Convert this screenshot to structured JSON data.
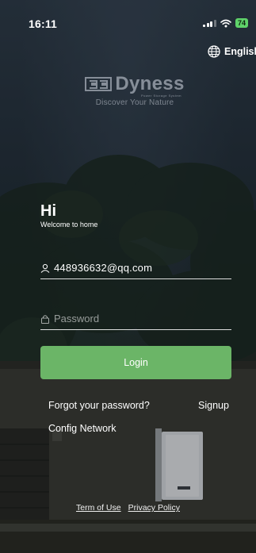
{
  "status_bar": {
    "time": "16:11",
    "battery": "74"
  },
  "language": {
    "label": "English",
    "icon": "globe-icon"
  },
  "brand": {
    "name": "Dyness",
    "subtitle": "Power Storage System",
    "tagline": "Discover Your Nature"
  },
  "greeting": {
    "title": "Hi",
    "subtitle": "Welcome to home"
  },
  "form": {
    "username_value": "448936632@qq.com",
    "username_icon": "user-icon",
    "password_placeholder": "Password",
    "password_icon": "lock-icon",
    "login_label": "Login"
  },
  "links": {
    "forgot": "Forgot your password?",
    "signup": "Signup",
    "config": "Config Network"
  },
  "footer": {
    "terms": "Term of Use",
    "privacy": "Privacy Policy"
  },
  "colors": {
    "accent": "#6bb567",
    "battery": "#5fd36a"
  }
}
